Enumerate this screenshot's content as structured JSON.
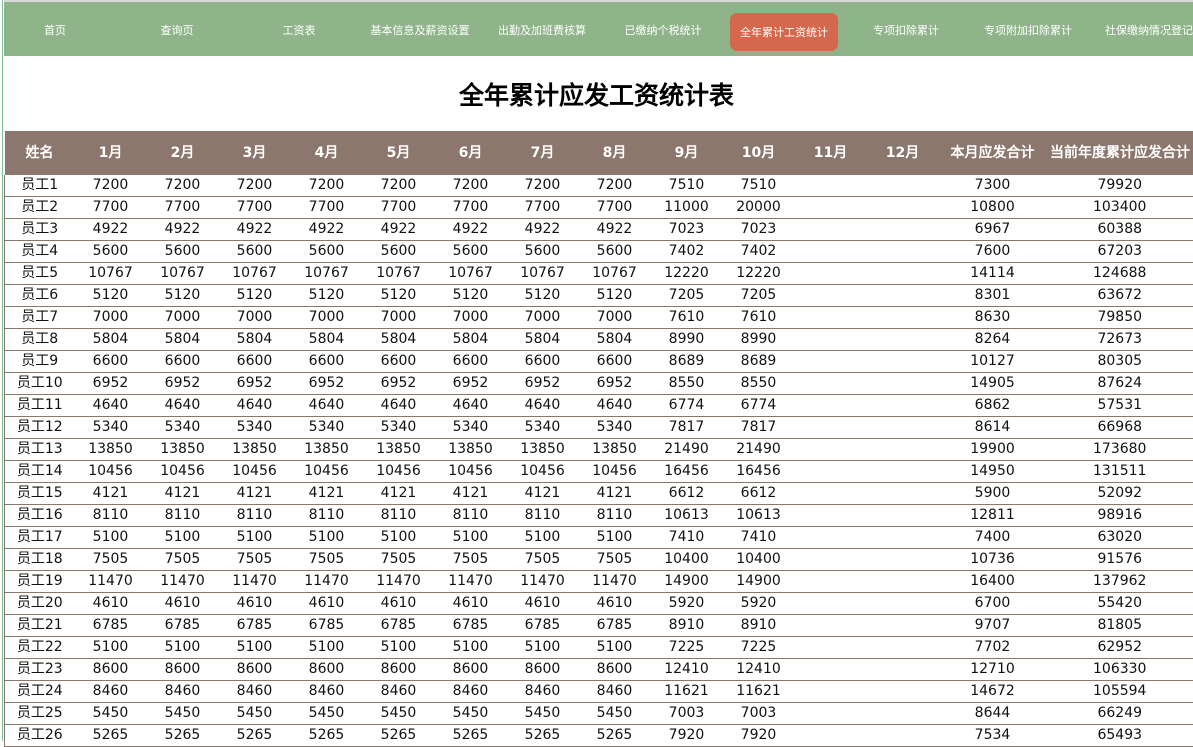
{
  "nav": {
    "items": [
      {
        "label": "首页"
      },
      {
        "label": "查询页"
      },
      {
        "label": "工资表"
      },
      {
        "label": "基本信息及薪资设置"
      },
      {
        "label": "出勤及加班费核算"
      },
      {
        "label": "已缴纳个税统计"
      },
      {
        "label": "全年累计工资统计",
        "active": true
      },
      {
        "label": "专项扣除累计"
      },
      {
        "label": "专项附加扣除累计"
      },
      {
        "label": "社保缴纳情况登记"
      }
    ]
  },
  "title": "全年累计应发工资统计表",
  "table": {
    "headers": [
      "姓名",
      "1月",
      "2月",
      "3月",
      "4月",
      "5月",
      "6月",
      "7月",
      "8月",
      "9月",
      "10月",
      "11月",
      "12月",
      "本月应发合计",
      "当前年度累计应发合计"
    ],
    "rows": [
      [
        "员工1",
        "7200",
        "7200",
        "7200",
        "7200",
        "7200",
        "7200",
        "7200",
        "7200",
        "7510",
        "7510",
        "",
        "",
        "7300",
        "79920"
      ],
      [
        "员工2",
        "7700",
        "7700",
        "7700",
        "7700",
        "7700",
        "7700",
        "7700",
        "7700",
        "11000",
        "20000",
        "",
        "",
        "10800",
        "103400"
      ],
      [
        "员工3",
        "4922",
        "4922",
        "4922",
        "4922",
        "4922",
        "4922",
        "4922",
        "4922",
        "7023",
        "7023",
        "",
        "",
        "6967",
        "60388"
      ],
      [
        "员工4",
        "5600",
        "5600",
        "5600",
        "5600",
        "5600",
        "5600",
        "5600",
        "5600",
        "7402",
        "7402",
        "",
        "",
        "7600",
        "67203"
      ],
      [
        "员工5",
        "10767",
        "10767",
        "10767",
        "10767",
        "10767",
        "10767",
        "10767",
        "10767",
        "12220",
        "12220",
        "",
        "",
        "14114",
        "124688"
      ],
      [
        "员工6",
        "5120",
        "5120",
        "5120",
        "5120",
        "5120",
        "5120",
        "5120",
        "5120",
        "7205",
        "7205",
        "",
        "",
        "8301",
        "63672"
      ],
      [
        "员工7",
        "7000",
        "7000",
        "7000",
        "7000",
        "7000",
        "7000",
        "7000",
        "7000",
        "7610",
        "7610",
        "",
        "",
        "8630",
        "79850"
      ],
      [
        "员工8",
        "5804",
        "5804",
        "5804",
        "5804",
        "5804",
        "5804",
        "5804",
        "5804",
        "8990",
        "8990",
        "",
        "",
        "8264",
        "72673"
      ],
      [
        "员工9",
        "6600",
        "6600",
        "6600",
        "6600",
        "6600",
        "6600",
        "6600",
        "6600",
        "8689",
        "8689",
        "",
        "",
        "10127",
        "80305"
      ],
      [
        "员工10",
        "6952",
        "6952",
        "6952",
        "6952",
        "6952",
        "6952",
        "6952",
        "6952",
        "8550",
        "8550",
        "",
        "",
        "14905",
        "87624"
      ],
      [
        "员工11",
        "4640",
        "4640",
        "4640",
        "4640",
        "4640",
        "4640",
        "4640",
        "4640",
        "6774",
        "6774",
        "",
        "",
        "6862",
        "57531"
      ],
      [
        "员工12",
        "5340",
        "5340",
        "5340",
        "5340",
        "5340",
        "5340",
        "5340",
        "5340",
        "7817",
        "7817",
        "",
        "",
        "8614",
        "66968"
      ],
      [
        "员工13",
        "13850",
        "13850",
        "13850",
        "13850",
        "13850",
        "13850",
        "13850",
        "13850",
        "21490",
        "21490",
        "",
        "",
        "19900",
        "173680"
      ],
      [
        "员工14",
        "10456",
        "10456",
        "10456",
        "10456",
        "10456",
        "10456",
        "10456",
        "10456",
        "16456",
        "16456",
        "",
        "",
        "14950",
        "131511"
      ],
      [
        "员工15",
        "4121",
        "4121",
        "4121",
        "4121",
        "4121",
        "4121",
        "4121",
        "4121",
        "6612",
        "6612",
        "",
        "",
        "5900",
        "52092"
      ],
      [
        "员工16",
        "8110",
        "8110",
        "8110",
        "8110",
        "8110",
        "8110",
        "8110",
        "8110",
        "10613",
        "10613",
        "",
        "",
        "12811",
        "98916"
      ],
      [
        "员工17",
        "5100",
        "5100",
        "5100",
        "5100",
        "5100",
        "5100",
        "5100",
        "5100",
        "7410",
        "7410",
        "",
        "",
        "7400",
        "63020"
      ],
      [
        "员工18",
        "7505",
        "7505",
        "7505",
        "7505",
        "7505",
        "7505",
        "7505",
        "7505",
        "10400",
        "10400",
        "",
        "",
        "10736",
        "91576"
      ],
      [
        "员工19",
        "11470",
        "11470",
        "11470",
        "11470",
        "11470",
        "11470",
        "11470",
        "11470",
        "14900",
        "14900",
        "",
        "",
        "16400",
        "137962"
      ],
      [
        "员工20",
        "4610",
        "4610",
        "4610",
        "4610",
        "4610",
        "4610",
        "4610",
        "4610",
        "5920",
        "5920",
        "",
        "",
        "6700",
        "55420"
      ],
      [
        "员工21",
        "6785",
        "6785",
        "6785",
        "6785",
        "6785",
        "6785",
        "6785",
        "6785",
        "8910",
        "8910",
        "",
        "",
        "9707",
        "81805"
      ],
      [
        "员工22",
        "5100",
        "5100",
        "5100",
        "5100",
        "5100",
        "5100",
        "5100",
        "5100",
        "7225",
        "7225",
        "",
        "",
        "7702",
        "62952"
      ],
      [
        "员工23",
        "8600",
        "8600",
        "8600",
        "8600",
        "8600",
        "8600",
        "8600",
        "8600",
        "12410",
        "12410",
        "",
        "",
        "12710",
        "106330"
      ],
      [
        "员工24",
        "8460",
        "8460",
        "8460",
        "8460",
        "8460",
        "8460",
        "8460",
        "8460",
        "11621",
        "11621",
        "",
        "",
        "14672",
        "105594"
      ],
      [
        "员工25",
        "5450",
        "5450",
        "5450",
        "5450",
        "5450",
        "5450",
        "5450",
        "5450",
        "7003",
        "7003",
        "",
        "",
        "8644",
        "66249"
      ],
      [
        "员工26",
        "5265",
        "5265",
        "5265",
        "5265",
        "5265",
        "5265",
        "5265",
        "5265",
        "7920",
        "7920",
        "",
        "",
        "7534",
        "65493"
      ]
    ]
  }
}
